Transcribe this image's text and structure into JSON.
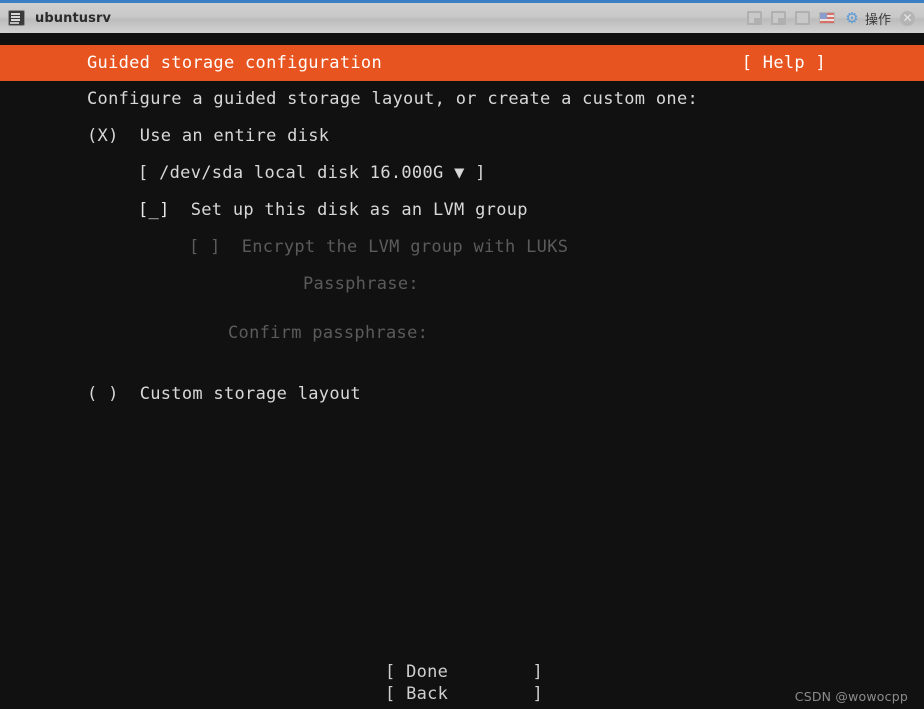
{
  "window": {
    "title": "ubuntusrv",
    "app_icon": "terminal-icon",
    "controls": [
      {
        "name": "window-restore-icon",
        "glyph": "restore"
      },
      {
        "name": "window-minimize-icon",
        "glyph": "minimize"
      },
      {
        "name": "window-maximize-icon",
        "glyph": "maximize"
      },
      {
        "name": "keyboard-layout-flag-icon",
        "glyph": "us-flag"
      },
      {
        "name": "gear-icon",
        "glyph": "⚙"
      }
    ],
    "action_label": "操作",
    "close_label": "✕",
    "accent_top": "#3b7ec1",
    "chrome_bg": "#c9c9c9"
  },
  "header": {
    "title": "Guided storage configuration",
    "help_label": "[ Help ]",
    "bg": "#e8541f",
    "fg": "#ffffff"
  },
  "body": {
    "intro": "Configure a guided storage layout, or create a custom one:",
    "entire_disk": {
      "radio": "(X)",
      "label": "Use an entire disk"
    },
    "disk_select": {
      "open_bracket": "[",
      "value": "/dev/sda local disk 16.000G",
      "arrow": "▼",
      "close_bracket": "]"
    },
    "lvm": {
      "checkbox": "[_]",
      "label": "Set up this disk as an LVM group"
    },
    "encrypt": {
      "checkbox": "[ ]",
      "label": "Encrypt the LVM group with LUKS"
    },
    "passphrase_label": "Passphrase:",
    "confirm_passphrase_label": "Confirm passphrase:",
    "custom_layout": {
      "radio": "( )",
      "label": "Custom storage layout"
    }
  },
  "footer": {
    "done": "[ Done        ]",
    "back": "[ Back        ]",
    "watermark": "CSDN @wowocpp"
  },
  "colors": {
    "terminal_bg": "#111111",
    "terminal_fg": "#d8d8d8",
    "disabled_fg": "#5b5b5b"
  }
}
